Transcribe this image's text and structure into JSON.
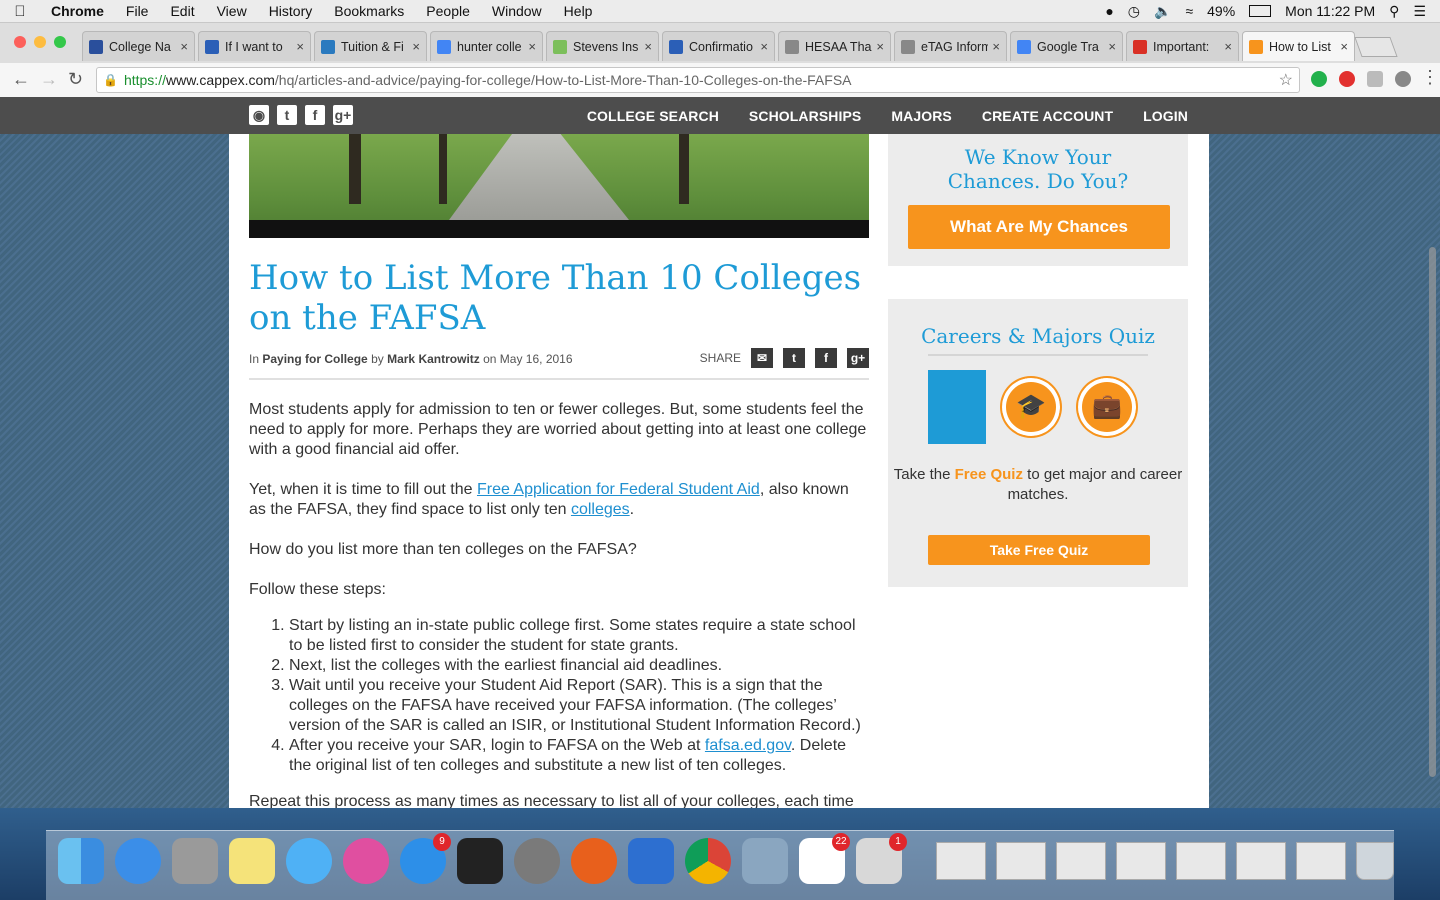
{
  "menubar": {
    "app": "Chrome",
    "items": [
      "File",
      "Edit",
      "View",
      "History",
      "Bookmarks",
      "People",
      "Window",
      "Help"
    ],
    "battery": "49%",
    "clock": "Mon 11:22 PM"
  },
  "tabs": [
    {
      "title": "College Na",
      "color": "#2a4f9c"
    },
    {
      "title": "If I want to",
      "color": "#2b5fb7"
    },
    {
      "title": "Tuition & Fi",
      "color": "#2a7abf"
    },
    {
      "title": "hunter colle",
      "color": "#4285f4"
    },
    {
      "title": "Stevens Ins",
      "color": "#7cbf5b"
    },
    {
      "title": "Confirmatio",
      "color": "#2b5fb7"
    },
    {
      "title": "HESAA Tha",
      "color": "#888888"
    },
    {
      "title": "eTAG Inform",
      "color": "#888888"
    },
    {
      "title": "Google Tra",
      "color": "#4285f4"
    },
    {
      "title": "Important:",
      "color": "#d93025"
    },
    {
      "title": "How to List",
      "color": "#f7941d"
    }
  ],
  "address": {
    "https": "https://",
    "host": "www.cappex.com",
    "path": "/hq/articles-and-advice/paying-for-college/How-to-List-More-Than-10-Colleges-on-the-FAFSA"
  },
  "nav": {
    "links": [
      "COLLEGE SEARCH",
      "SCHOLARSHIPS",
      "MAJORS",
      "CREATE ACCOUNT",
      "LOGIN"
    ]
  },
  "article": {
    "title": "How to List More Than 10 Colleges on the FAFSA",
    "by_in": "In",
    "category": "Paying for College",
    "by": "by",
    "author": "Mark Kantrowitz",
    "on": "on May 16, 2016",
    "share": "SHARE",
    "p1": "Most students apply for admission to ten or fewer colleges. But, some students feel the need to apply for more. Perhaps they are worried about getting into at least one college with a good financial aid offer.",
    "p2_a": "Yet, when it is time to fill out the ",
    "p2_link1": "Free Application for Federal Student Aid",
    "p2_b": ", also known as the FAFSA, they find space to list only ten ",
    "p2_link2": "colleges",
    "p2_c": ".",
    "p3": "How do you list more than ten colleges on the FAFSA?",
    "p4": "Follow these steps:",
    "steps": [
      "Start by listing an in-state public college first. Some states require a state school to be listed first to consider the student for state grants.",
      "Next, list the colleges with the earliest financial aid deadlines.",
      "Wait until you receive your Student Aid Report (SAR). This is a sign that the colleges on the FAFSA have received your FAFSA information. (The colleges’ version of the SAR is called an ISIR, or Institutional Student Information Record.)"
    ],
    "step4_a": "After you receive your SAR, login to FAFSA on the Web at ",
    "step4_link": "fafsa.ed.gov",
    "step4_b": ". Delete the original list of ten colleges and substitute a new list of ten colleges.",
    "p5": "Repeat this process as many times as necessary to list all of your colleges, each time"
  },
  "sidebar": {
    "chances_heading": "We Know Your Chances. Do You?",
    "chances_button": "What Are My Chances",
    "quiz_heading": "Careers & Majors Quiz",
    "quiz_text_a": "Take the ",
    "quiz_text_link": "Free Quiz",
    "quiz_text_b": " to get major and career matches.",
    "quiz_button": "Take Free Quiz"
  },
  "dock": {
    "badges": {
      "appstore": "9",
      "reminders": "22",
      "printer": "1"
    }
  }
}
